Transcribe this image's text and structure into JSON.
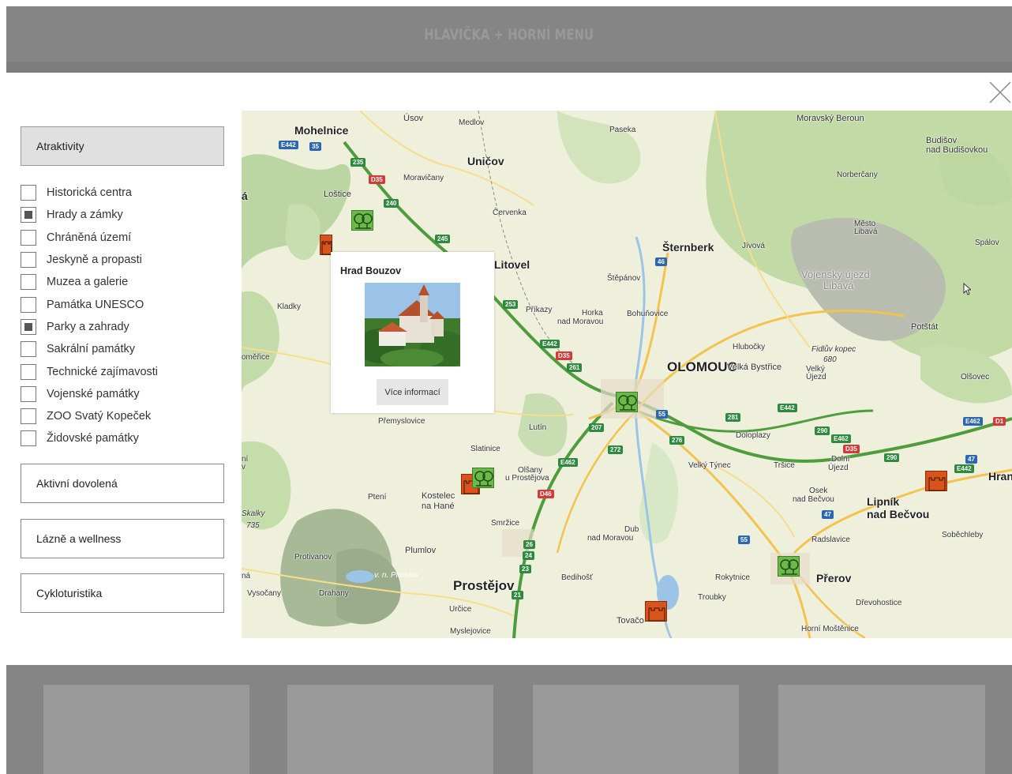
{
  "header": {
    "title": "HLAVIČKA + HORNÍ MENU"
  },
  "sidebar": {
    "active_category": "Atraktivity",
    "filters": [
      {
        "label": "Historická centra",
        "checked": false
      },
      {
        "label": "Hrady a zámky",
        "checked": true
      },
      {
        "label": "Chráněná území",
        "checked": false
      },
      {
        "label": "Jeskyně a propasti",
        "checked": false
      },
      {
        "label": "Muzea a galerie",
        "checked": false
      },
      {
        "label": "Památka UNESCO",
        "checked": false
      },
      {
        "label": "Parky a zahrady",
        "checked": true
      },
      {
        "label": "Sakrální památky",
        "checked": false
      },
      {
        "label": "Technické zajímavosti",
        "checked": false
      },
      {
        "label": "Vojenské památky",
        "checked": false
      },
      {
        "label": "ZOO Svatý Kopeček",
        "checked": false
      },
      {
        "label": "Židovské památky",
        "checked": false
      }
    ],
    "other_categories": [
      "Aktivní dovolená",
      "Lázně a wellness",
      "Cykloturistika"
    ]
  },
  "map": {
    "labels": {
      "mohelnice": "Mohelnice",
      "usov": "Úsov",
      "medlov": "Medlov",
      "paseka": "Paseka",
      "moravsky_beroun": "Moravský Beroun",
      "budisov": "Budišov",
      "budisov2": "nad Budišovkou",
      "unicov": "Uničov",
      "moravicany": "Moravičany",
      "lostice": "Loštice",
      "cervenka": "Červenka",
      "norbercany": "Norberčany",
      "sternberk": "Šternberk",
      "jivova": "Jívová",
      "mesto_libava": "Město",
      "mesto_libava2": "Libavá",
      "spalov": "Spálov",
      "litovel": "Litovel",
      "stepanov": "Štěpánov",
      "vojensky": "Vojenský újezd",
      "vojensky2": "Libavá",
      "kladky": "Kladky",
      "prikazy": "Příkazy",
      "horka": "Horka",
      "horka2": "nad Moravou",
      "bohunovice": "Bohuňovice",
      "potstat": "Potštát",
      "hlubocky": "Hlubočky",
      "fidluv": "Fidlův kopec",
      "fidluv_alt": "680",
      "olomouc": "OLOMOUC",
      "velka_bystrice": "Velká Bystřice",
      "velky_ujezd": "Velký",
      "velky_ujezd2": "Újezd",
      "olsovec": "Olšovec",
      "premyslovice": "Přemyslovice",
      "lutin": "Lutín",
      "dolopazy": "Doloplazy",
      "slatinice": "Slatinice",
      "olsany": "Olšany",
      "olsany2": "u Prostějova",
      "velky_tynec": "Velký Týnec",
      "trsice": "Tršice",
      "dolni_ujezd": "Dolní",
      "dolni_ujezd2": "Újezd",
      "hranice": "Hrani",
      "pteni": "Ptení",
      "kostelec": "Kostelec",
      "kostelec2": "na Hané",
      "osek": "Osek",
      "osek2": "nad Bečvou",
      "lipnik": "Lipník",
      "lipnik2": "nad Bečvou",
      "smrzice": "Smržice",
      "skalky": "Skalky",
      "skalky_alt": "735",
      "dub": "Dub",
      "dub2": "nad Moravou",
      "radslavice": "Radslavice",
      "sobechleby": "Soběchleby",
      "plumlov": "Plumlov",
      "protivanov": "Protivanov",
      "vn_plumlov": "v. n. Plumlov",
      "bedihost": "Bedihošť",
      "rokytnice": "Rokytnice",
      "prerov": "Přerov",
      "vysocany": "Vysočany",
      "drahany": "Drahany",
      "prostejov": "Prostějov",
      "troubky": "Troubky",
      "drevohostice": "Dřevohostice",
      "urcice": "Určice",
      "tovacov": "Tovačo",
      "myslejovice": "Myslejovice",
      "horni_mostenice": "Horní Moštěnice",
      "na": "ná",
      "a": "á",
      "omerice": "oměřice",
      "ni": "ní",
      "na2": "ná",
      "v": "v"
    },
    "road_shields": [
      "E442",
      "35",
      "235",
      "D35",
      "240",
      "245",
      "46",
      "253",
      "E442",
      "D35",
      "261",
      "55",
      "207",
      "281",
      "272",
      "276",
      "E442",
      "290",
      "E462",
      "D35",
      "290",
      "E462",
      "D1",
      "47",
      "E442",
      "E462",
      "D46",
      "47",
      "55",
      "24",
      "23",
      "26",
      "21"
    ]
  },
  "popup": {
    "title": "Hrad Bouzov",
    "button": "Více informací"
  }
}
